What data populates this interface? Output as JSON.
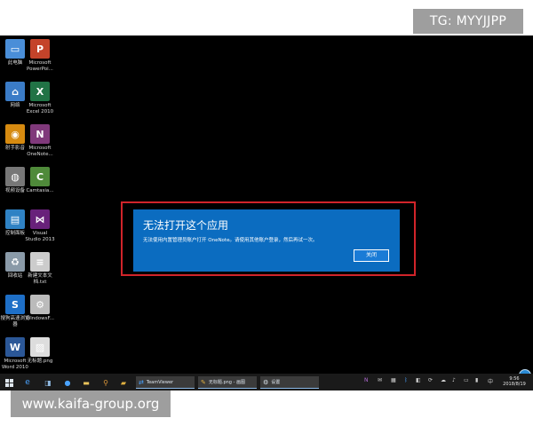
{
  "watermarks": {
    "top": "TG: MYYJJPP",
    "bottom": "www.kaifa-group.org"
  },
  "desktop_icons": [
    {
      "label": "此电脑",
      "icon": "pc-icon",
      "color": "#4a8ed8",
      "glyph": "▭"
    },
    {
      "label": "Microsoft\nPowerPoi...",
      "icon": "powerpoint-icon",
      "color": "#c4432a",
      "glyph": "P"
    },
    {
      "label": "网络",
      "icon": "network-icon",
      "color": "#3b7cc7",
      "glyph": "⌂"
    },
    {
      "label": "Microsoft\nExcel 2010",
      "icon": "excel-icon",
      "color": "#217346",
      "glyph": "X"
    },
    {
      "label": "射手影音",
      "icon": "media-player-icon",
      "color": "#d68a10",
      "glyph": "◉"
    },
    {
      "label": "Microsoft\nOneNote...",
      "icon": "onenote-icon",
      "color": "#80397b",
      "glyph": "N"
    },
    {
      "label": "视频设备",
      "icon": "camera-icon",
      "color": "#777777",
      "glyph": "◍"
    },
    {
      "label": "Camtasia...",
      "icon": "camtasia-icon",
      "color": "#4f8a3a",
      "glyph": "C"
    },
    {
      "label": "控制面板",
      "icon": "control-panel-icon",
      "color": "#2f82c4",
      "glyph": "▤"
    },
    {
      "label": "Visual\nStudio 2013",
      "icon": "visual-studio-icon",
      "color": "#68217a",
      "glyph": "⋈"
    },
    {
      "label": "回收站",
      "icon": "recycle-bin-icon",
      "color": "#8a9aa8",
      "glyph": "♻"
    },
    {
      "label": "新建文本文\n档.txt",
      "icon": "text-file-icon",
      "color": "#cccccc",
      "glyph": "≡"
    },
    {
      "label": "搜狗高速浏览\n器",
      "icon": "sogou-browser-icon",
      "color": "#1e6fc7",
      "glyph": "S"
    },
    {
      "label": "WindowsF...",
      "icon": "windows-file-icon",
      "color": "#bbbbbb",
      "glyph": "⚙"
    },
    {
      "label": "Microsoft\nWord 2010",
      "icon": "word-icon",
      "color": "#2b5797",
      "glyph": "W"
    },
    {
      "label": "无标题.png",
      "icon": "image-file-icon",
      "color": "#dddddd",
      "glyph": "▨"
    }
  ],
  "dialog": {
    "title": "无法打开这个应用",
    "message": "无法使用内置管理员账户打开 OneNote。请使用其他账户登录，然后再试一次。",
    "close_label": "关闭"
  },
  "taskbar": {
    "apps": [
      {
        "label": "TeamViewer",
        "icon": "teamviewer-icon"
      },
      {
        "label": "无标题.png - 画图",
        "icon": "paint-icon"
      },
      {
        "label": "设置",
        "icon": "settings-icon"
      }
    ],
    "tray_ime": "中",
    "clock_time": "9:56",
    "clock_date": "2018/8/19"
  }
}
